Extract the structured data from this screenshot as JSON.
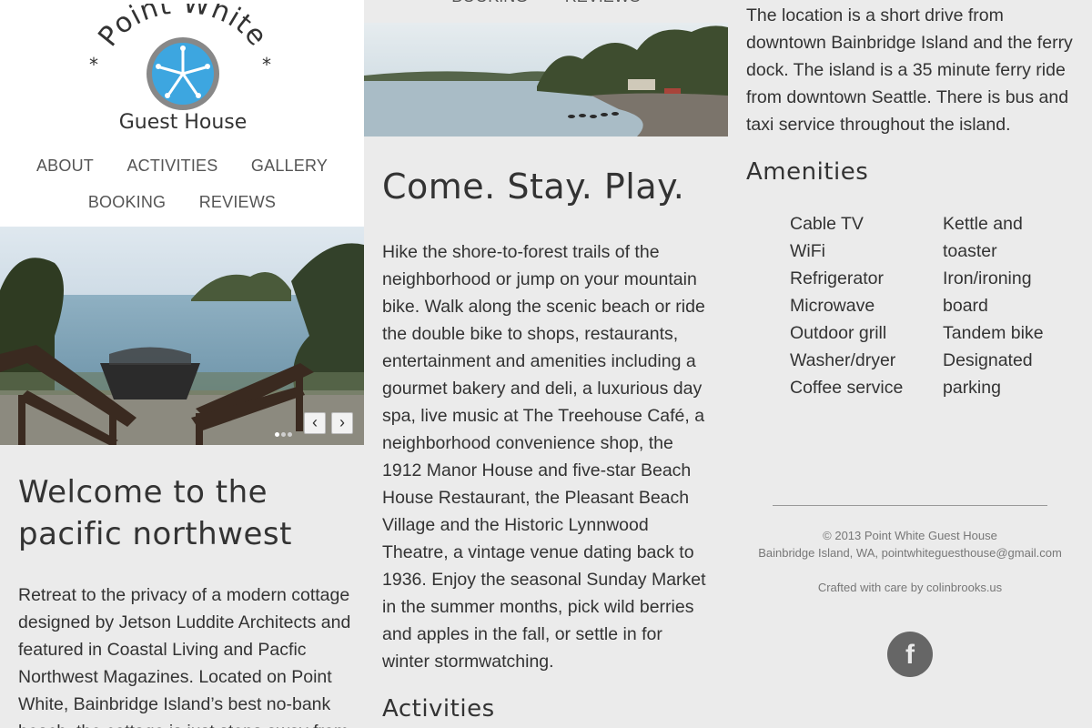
{
  "logo": {
    "line1": "Point White",
    "line2": "Guest House"
  },
  "nav": {
    "row1": [
      "ABOUT",
      "ACTIVITIES",
      "GALLERY"
    ],
    "row2": [
      "BOOKING",
      "REVIEWS"
    ]
  },
  "slider": {
    "prev_icon": "chevron-left-icon",
    "next_icon": "chevron-right-icon",
    "prev": "‹",
    "next": "›"
  },
  "welcome": {
    "title": "Welcome to the pacific northwest",
    "text": "Retreat to the privacy of a modern cottage designed by Jetson Luddite Architects and featured in Coastal Living and Pacfic Northwest Magazines. Located on Point White, Bainbridge Island’s best no-bank beach, the cottage is just steps away from"
  },
  "stay": {
    "title": "Come. Stay. Play.",
    "text": "Hike the shore-to-forest trails of the neighborhood or jump on your mountain bike. Walk along the scenic beach or ride the double bike to shops, restaurants, entertainment and amenities including a gourmet bakery and deli, a luxurious day spa, live music at The Treehouse Café, a neighborhood convenience shop, the 1912 Manor House and five-star Beach House Restaurant, the Pleasant Beach Village and the Historic Lynnwood Theatre, a vintage venue dating back to 1936. Enjoy the seasonal Sunday Market in the summer months, pick wild berries and apples in the fall, or settle in for winter stormwatching.",
    "activities_heading": "Activities"
  },
  "location": {
    "text": "The location is a short drive from downtown Bainbridge Island and the ferry dock. The island is a 35 minute ferry ride from downtown Seattle. There is bus and taxi service throughout the island."
  },
  "amenities": {
    "title": "Amenities",
    "col1": [
      "Cable TV",
      "WiFi",
      "Refrigerator",
      "Microwave",
      "Outdoor grill",
      "Washer/dryer",
      "Coffee service"
    ],
    "col2": [
      "Kettle and toaster",
      "Iron/ironing board",
      "Tandem bike",
      "Designated parking"
    ]
  },
  "footer": {
    "copyright": "© 2013 Point White Guest House",
    "address": "Bainbridge Island, WA, pointwhiteguesthouse@gmail.com",
    "crafted": "Crafted with care by colinbrooks.us",
    "facebook_icon": "facebook-icon",
    "facebook_glyph": "f"
  },
  "colors": {
    "background": "#ebebeb",
    "header_bg": "#ffffff",
    "logo_blue": "#3da6e0",
    "text": "#333333",
    "nav_text": "#555555"
  }
}
